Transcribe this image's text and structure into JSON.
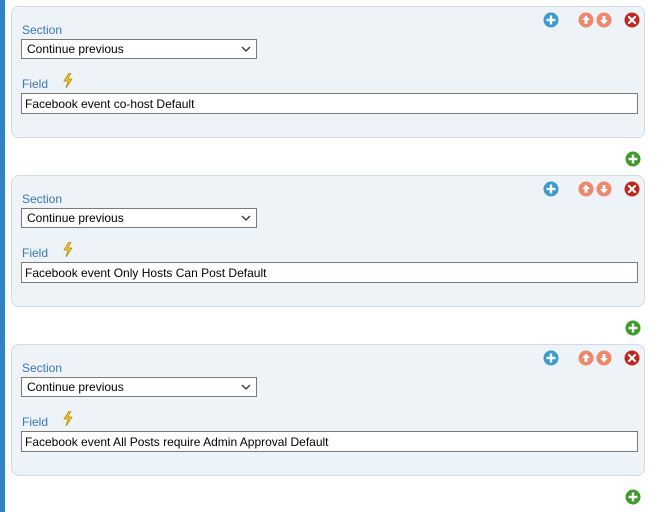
{
  "rows": [
    {
      "section_label": "Section",
      "section_value": "Continue previous",
      "field_label": "Field",
      "field_value": "Facebook event co-host Default"
    },
    {
      "section_label": "Section",
      "section_value": "Continue previous",
      "field_label": "Field",
      "field_value": "Facebook event Only Hosts Can Post Default"
    },
    {
      "section_label": "Section",
      "section_value": "Continue previous",
      "field_label": "Field",
      "field_value": "Facebook event All Posts require Admin Approval Default"
    }
  ],
  "icons": {
    "add": "plus-circle-icon",
    "move_up": "arrow-up-icon",
    "move_down": "arrow-down-icon",
    "delete": "close-icon",
    "add_row": "plus-circle-icon",
    "field_hint": "lightning-icon"
  },
  "colors": {
    "accent_blue": "#3b9ad0",
    "move_orange": "#f0866a",
    "delete_red": "#c0281f",
    "add_green": "#3f9a2b",
    "label_blue": "#3b77b5",
    "panel_bg": "#eef3f8",
    "strip": "#2f83c4"
  }
}
